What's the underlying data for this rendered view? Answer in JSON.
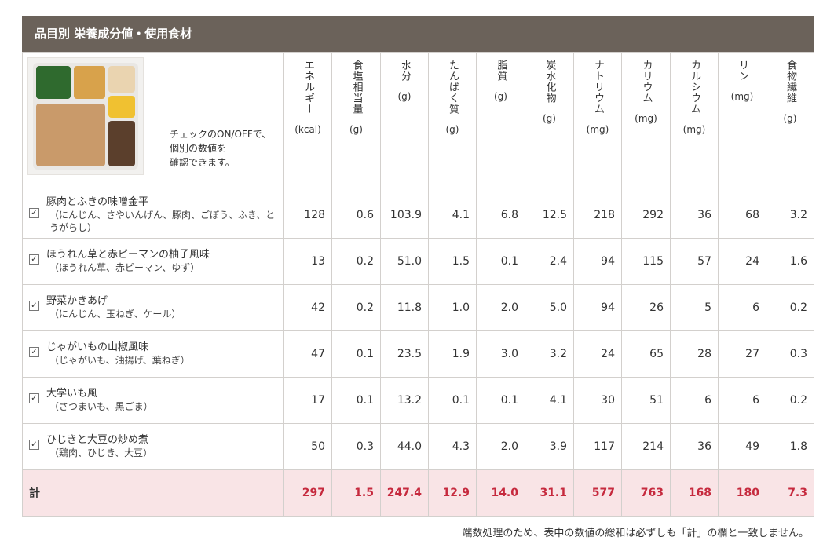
{
  "panel": {
    "title": "品目別 栄養成分値・使用食材",
    "note_lines": [
      "チェックのON/OFFで、",
      "個別の数値を",
      "確認できます。"
    ]
  },
  "columns": [
    {
      "label": "エネルギー",
      "unit": "(kcal)"
    },
    {
      "label": "食塩相当量",
      "unit": "(g)"
    },
    {
      "label": "水分",
      "unit": "(g)"
    },
    {
      "label": "たんぱく質",
      "unit": "(g)"
    },
    {
      "label": "脂質",
      "unit": "(g)"
    },
    {
      "label": "炭水化物",
      "unit": "(g)"
    },
    {
      "label": "ナトリウム",
      "unit": "(mg)"
    },
    {
      "label": "カリウム",
      "unit": "(mg)"
    },
    {
      "label": "カルシウム",
      "unit": "(mg)"
    },
    {
      "label": "リン",
      "unit": "(mg)"
    },
    {
      "label": "食物繊維",
      "unit": "(g)"
    }
  ],
  "rows": [
    {
      "name": "豚肉とふきの味噌金平",
      "ingredients": "（にんじん、さやいんげん、豚肉、ごぼう、ふき、とうがらし）",
      "checked": true,
      "values": [
        "128",
        "0.6",
        "103.9",
        "4.1",
        "6.8",
        "12.5",
        "218",
        "292",
        "36",
        "68",
        "3.2"
      ]
    },
    {
      "name": "ほうれん草と赤ピーマンの柚子風味",
      "ingredients": "（ほうれん草、赤ピーマン、ゆず）",
      "checked": true,
      "values": [
        "13",
        "0.2",
        "51.0",
        "1.5",
        "0.1",
        "2.4",
        "94",
        "115",
        "57",
        "24",
        "1.6"
      ]
    },
    {
      "name": "野菜かきあげ",
      "ingredients": "（にんじん、玉ねぎ、ケール）",
      "checked": true,
      "values": [
        "42",
        "0.2",
        "11.8",
        "1.0",
        "2.0",
        "5.0",
        "94",
        "26",
        "5",
        "6",
        "0.2"
      ]
    },
    {
      "name": "じゃがいもの山椒風味",
      "ingredients": "（じゃがいも、油揚げ、葉ねぎ）",
      "checked": true,
      "values": [
        "47",
        "0.1",
        "23.5",
        "1.9",
        "3.0",
        "3.2",
        "24",
        "65",
        "28",
        "27",
        "0.3"
      ]
    },
    {
      "name": "大学いも風",
      "ingredients": "（さつまいも、黒ごま）",
      "checked": true,
      "values": [
        "17",
        "0.1",
        "13.2",
        "0.1",
        "0.1",
        "4.1",
        "30",
        "51",
        "6",
        "6",
        "0.2"
      ]
    },
    {
      "name": "ひじきと大豆の炒め煮",
      "ingredients": "（鶏肉、ひじき、大豆）",
      "checked": true,
      "values": [
        "50",
        "0.3",
        "44.0",
        "4.3",
        "2.0",
        "3.9",
        "117",
        "214",
        "36",
        "49",
        "1.8"
      ]
    }
  ],
  "total": {
    "label": "計",
    "values": [
      "297",
      "1.5",
      "247.4",
      "12.9",
      "14.0",
      "31.1",
      "577",
      "763",
      "168",
      "180",
      "7.3"
    ]
  },
  "footnote": "端数処理のため、表中の数値の総和は必ずしも「計」の欄と一致しません。",
  "icons": {
    "checkbox": "checkbox-icon",
    "check_glyph": "✓"
  },
  "colors": {
    "title_bar": "#6b625a",
    "total_bg": "#f9e4e6",
    "total_text": "#c62a3e",
    "border": "#d3d0cd"
  }
}
